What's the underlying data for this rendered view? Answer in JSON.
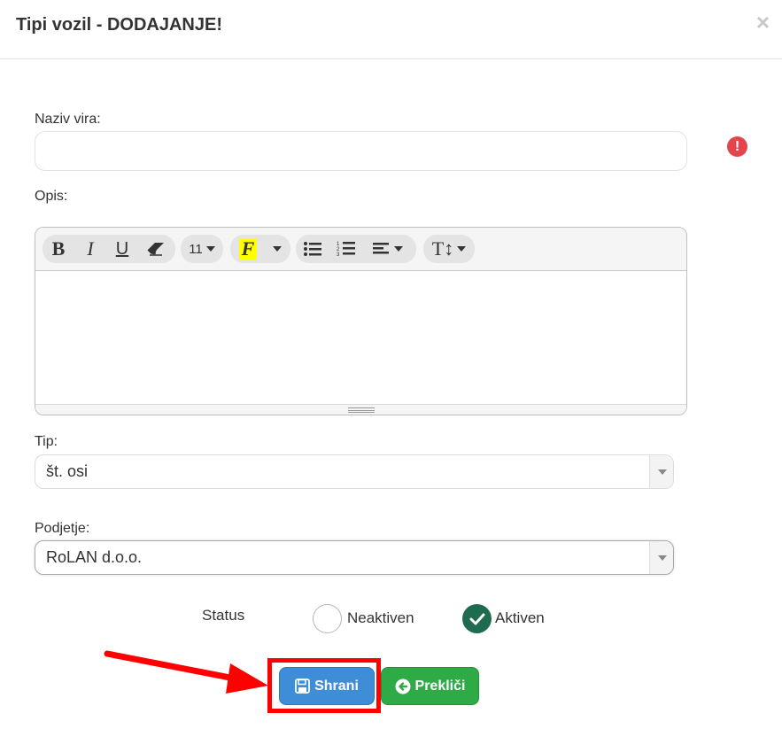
{
  "modal": {
    "title": "Tipi vozil - DODAJANJE!",
    "close_glyph": "×"
  },
  "form": {
    "naziv": {
      "label": "Naziv vira:",
      "value": "",
      "error_glyph": "!"
    },
    "opis": {
      "label": "Opis:",
      "toolbar": {
        "bold": "B",
        "italic": "I",
        "underline": "U",
        "font_size": "11",
        "font_color": "F",
        "height_glyph": "T↕"
      }
    },
    "tip": {
      "label": "Tip:",
      "value": "št. osi"
    },
    "podjetje": {
      "label": "Podjetje:",
      "value": "RoLAN d.o.o."
    },
    "status": {
      "label": "Status",
      "options": [
        {
          "label": "Neaktiven",
          "checked": false
        },
        {
          "label": "Aktiven",
          "checked": true
        }
      ]
    }
  },
  "buttons": {
    "save_label": "Shrani",
    "cancel_label": "Prekliči"
  },
  "colors": {
    "save": "#3e8dd7",
    "cancel": "#2eaa47",
    "checked": "#1e6b50",
    "error": "#e4454c",
    "highlight": "#ff0000",
    "font_color_highlight": "#ffff00"
  },
  "icons": {
    "close": "close-icon",
    "error": "exclamation-icon",
    "save": "floppy-disk-icon",
    "cancel": "arrow-left-circle-icon",
    "annotation_arrow": "red-arrow-icon"
  }
}
